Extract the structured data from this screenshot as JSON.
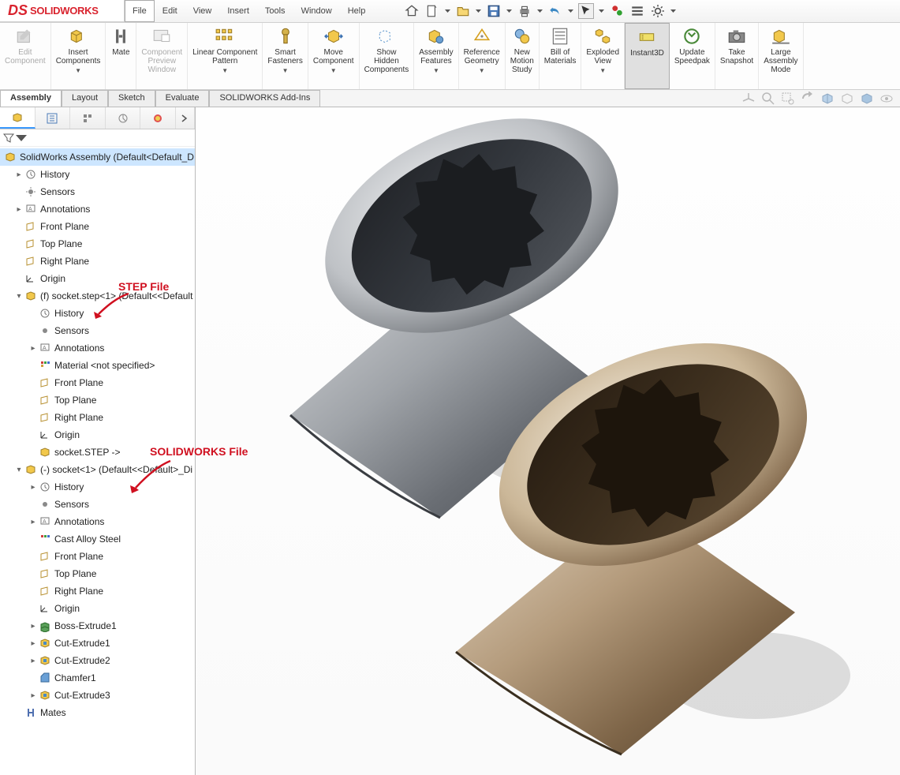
{
  "app": {
    "logo_text": "SOLIDWORKS",
    "logo_ds": "DS"
  },
  "menu": {
    "file": "File",
    "edit": "Edit",
    "view": "View",
    "insert": "Insert",
    "tools": "Tools",
    "window": "Window",
    "help": "Help"
  },
  "ribbon": {
    "edit_component": "Edit\nComponent",
    "insert_components": "Insert\nComponents",
    "mate": "Mate",
    "component_preview": "Component\nPreview\nWindow",
    "linear_pattern": "Linear Component\nPattern",
    "smart_fasteners": "Smart\nFasteners",
    "move_component": "Move\nComponent",
    "show_hidden": "Show\nHidden\nComponents",
    "assembly_features": "Assembly\nFeatures",
    "ref_geometry": "Reference\nGeometry",
    "new_motion": "New\nMotion\nStudy",
    "bom": "Bill of\nMaterials",
    "exploded": "Exploded\nView",
    "instant3d": "Instant3D",
    "update_sp": "Update\nSpeedpak",
    "take_snap": "Take\nSnapshot",
    "large_asm": "Large\nAssembly\nMode"
  },
  "tabs": {
    "assembly": "Assembly",
    "layout": "Layout",
    "sketch": "Sketch",
    "evaluate": "Evaluate",
    "addins": "SOLIDWORKS Add-Ins"
  },
  "tree": {
    "root": "SolidWorks Assembly  (Default<Default_D",
    "history": "History",
    "sensors": "Sensors",
    "annotations": "Annotations",
    "front_plane": "Front Plane",
    "top_plane": "Top Plane",
    "right_plane": "Right Plane",
    "origin": "Origin",
    "comp1": "(f) socket.step<1> (Default<<Default",
    "material_ns": "Material <not specified>",
    "socket_step": "socket.STEP ->",
    "comp2": "(-) socket<1> (Default<<Default>_Di",
    "cast_alloy": "Cast Alloy Steel",
    "boss_ext1": "Boss-Extrude1",
    "cut_ext1": "Cut-Extrude1",
    "cut_ext2": "Cut-Extrude2",
    "chamfer1": "Chamfer1",
    "cut_ext3": "Cut-Extrude3",
    "mates": "Mates"
  },
  "annotations": {
    "step": "STEP File",
    "sw": "SOLIDWORKS File"
  },
  "colors": {
    "accent_red": "#d9232e"
  }
}
